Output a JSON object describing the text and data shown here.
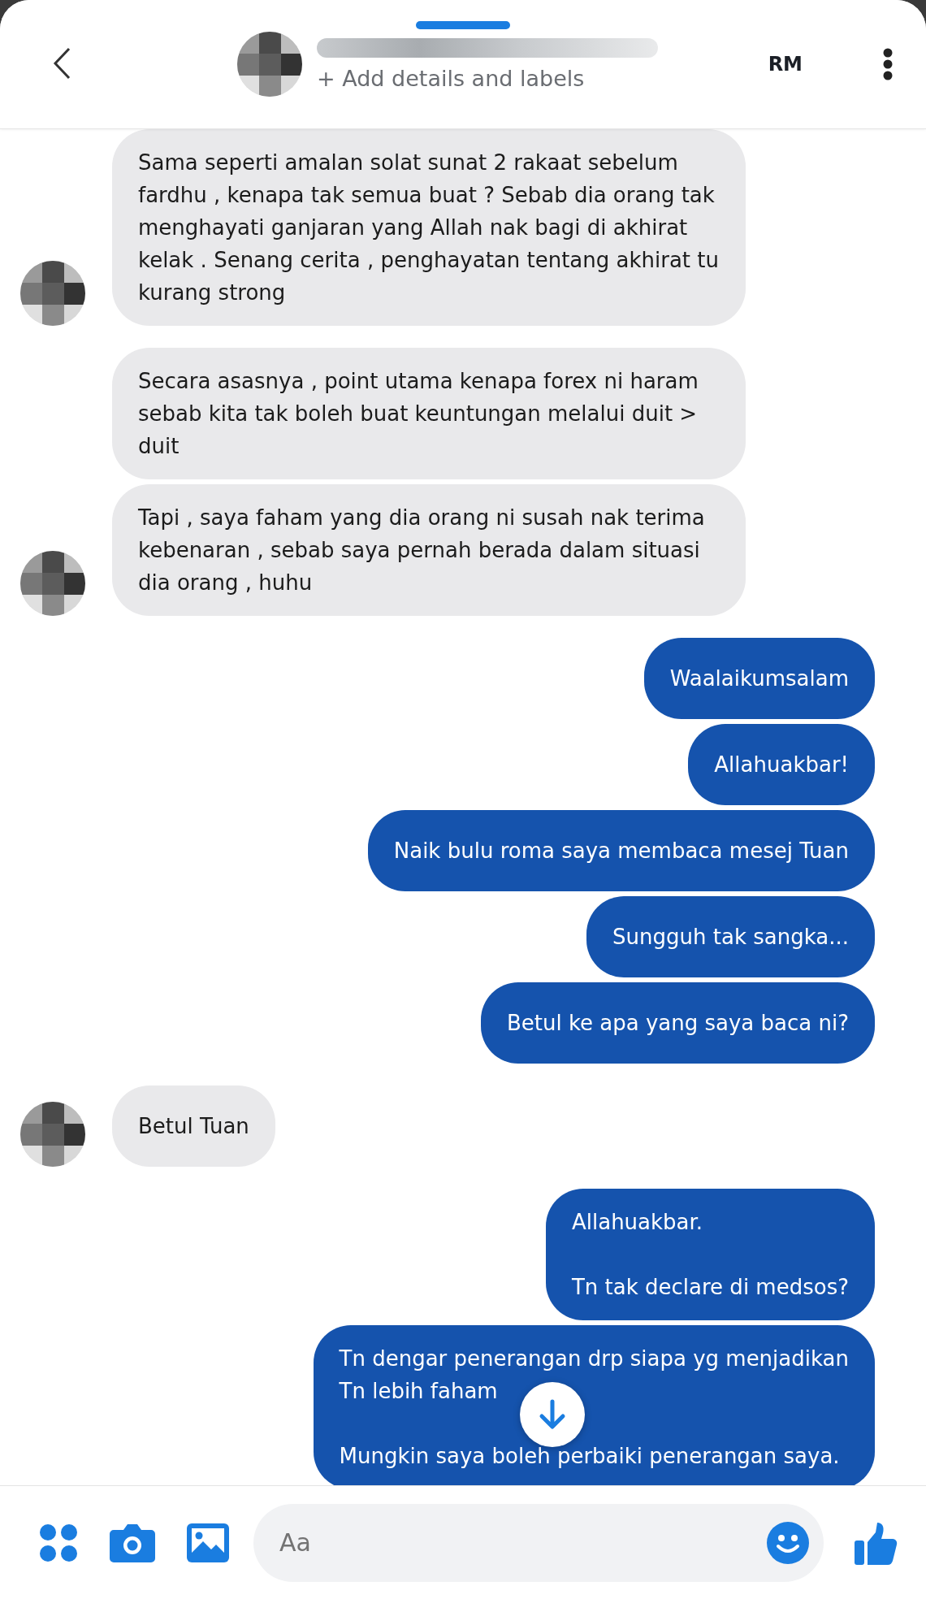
{
  "header": {
    "subtitle": "+ Add details and labels",
    "initials": "RM"
  },
  "messages": [
    {
      "kind": "incoming",
      "text": "Sama seperti amalan solat sunat 2 rakaat sebelum fardhu , kenapa tak semua buat ? Sebab dia orang tak menghayati ganjaran yang Allah nak bagi di akhirat kelak . Senang cerita , penghayatan tentang akhirat tu kurang strong",
      "avatar": true
    },
    {
      "kind": "incoming",
      "text": "Secara asasnya , point utama kenapa forex ni haram sebab kita tak boleh buat keuntungan melalui duit > duit",
      "avatar": false
    },
    {
      "kind": "incoming",
      "text": "Tapi , saya faham yang dia orang ni susah nak terima kebenaran , sebab saya pernah berada dalam situasi dia orang , huhu",
      "avatar": true
    },
    {
      "kind": "outgoing",
      "text": "Waalaikumsalam",
      "avatar": false
    },
    {
      "kind": "outgoing",
      "text": "Allahuakbar!",
      "avatar": false
    },
    {
      "kind": "outgoing",
      "text": "Naik bulu roma saya membaca mesej Tuan",
      "avatar": false
    },
    {
      "kind": "outgoing",
      "text": "Sungguh tak sangka...",
      "avatar": false
    },
    {
      "kind": "outgoing",
      "text": "Betul ke apa yang saya baca ni?",
      "avatar": false
    },
    {
      "kind": "incoming",
      "text": "Betul Tuan",
      "avatar": true
    },
    {
      "kind": "outgoing",
      "text": "Allahuakbar.\n\nTn tak declare di medsos?",
      "avatar": false
    },
    {
      "kind": "outgoing",
      "text": "Tn dengar penerangan drp siapa yg menjadikan\nTn lebih faham\n\nMungkin saya boleh perbaiki penerangan saya.",
      "avatar": false
    }
  ],
  "composer": {
    "placeholder": "Aa"
  }
}
